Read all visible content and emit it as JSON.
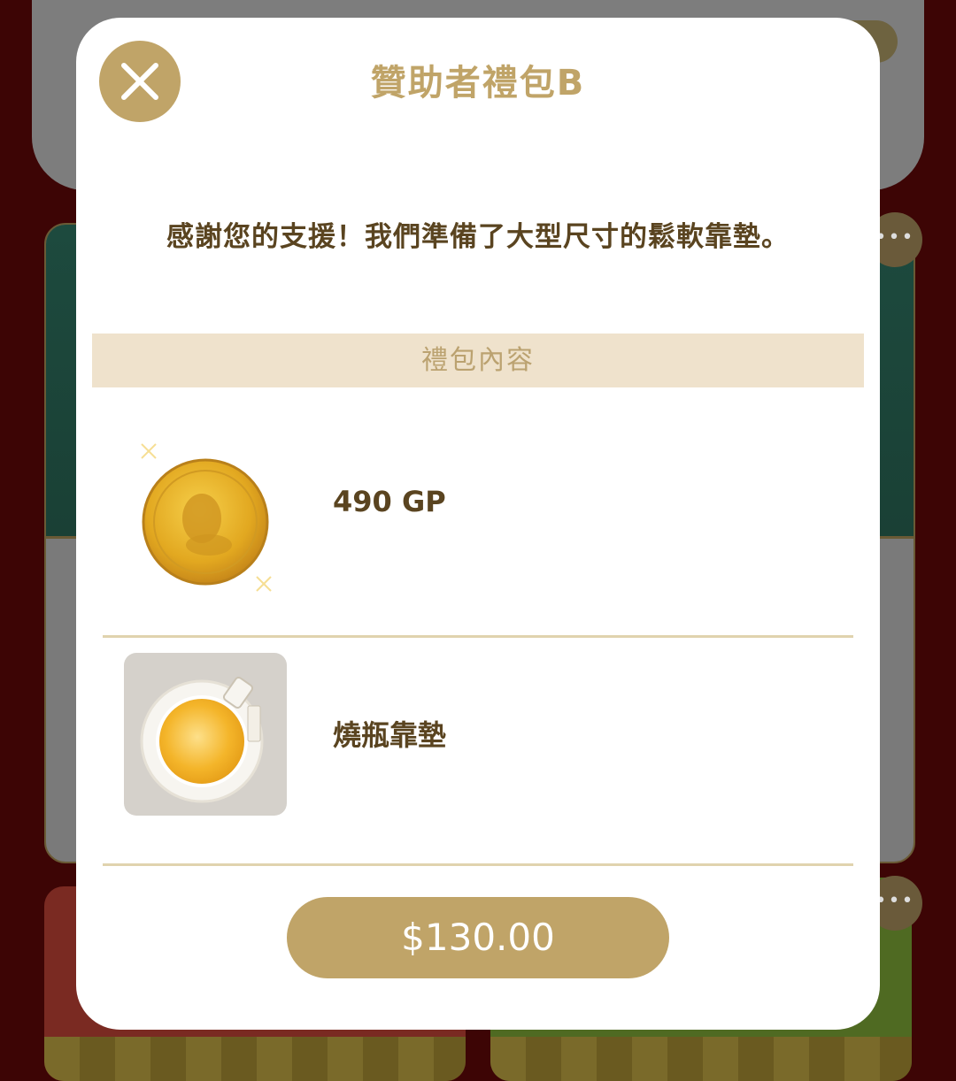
{
  "background": {
    "more_label": "•••"
  },
  "modal": {
    "title": "贊助者禮包B",
    "description": "感謝您的支援！我們準備了大型尺寸的鬆軟靠墊。",
    "section_header": "禮包內容",
    "items": [
      {
        "label": "490 GP",
        "icon": "gold-coin-icon"
      },
      {
        "label": "燒瓶靠墊",
        "icon": "flask-cushion-icon"
      }
    ],
    "price_label": "$130.00",
    "close_icon": "close-icon"
  },
  "colors": {
    "accent": "#c0a468",
    "text_brown": "#5a4420",
    "header_bg": "#efe2cc",
    "backdrop": "#3d0505"
  }
}
